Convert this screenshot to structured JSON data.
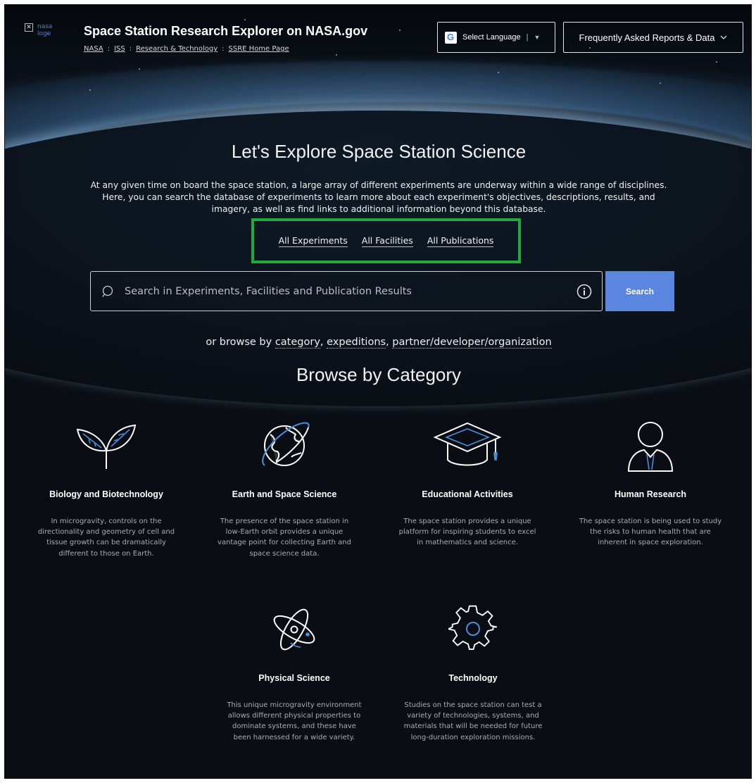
{
  "header": {
    "logo_alt": "nasa logo",
    "title": "Space Station Research Explorer on NASA.gov",
    "breadcrumbs": [
      "NASA",
      "ISS",
      "Research & Technology",
      "SSRE Home Page"
    ],
    "language_button": "Select Language",
    "language_divider": "|",
    "language_caret": "▼",
    "faq_button": "Frequently Asked Reports & Data"
  },
  "hero": {
    "title": "Let's Explore Space Station Science",
    "intro": "At any given time on board the space station, a large array of different experiments are underway within a wide range of disciplines. Here, you can search the database of experiments to learn more about each experiment's objectives, descriptions, results, and imagery, as well as find links to additional information beyond this database.",
    "links": [
      "All Experiments",
      "All Facilities",
      "All Publications"
    ]
  },
  "search": {
    "placeholder": "Search in Experiments, Facilities and Publication Results",
    "button": "Search"
  },
  "browse": {
    "prefix": "or browse by ",
    "links": [
      "category",
      "expeditions",
      "partner/developer/organization"
    ],
    "separator": ", ",
    "heading": "Browse by Category"
  },
  "categories": [
    {
      "label": "Biology and Biotechnology",
      "icon": "plant-sprout-icon",
      "desc": "In microgravity, controls on the directionality and geometry of cell and tissue growth can be dramatically different to those on Earth."
    },
    {
      "label": "Earth and Space Science",
      "icon": "globe-orbit-icon",
      "desc": "The presence of the space station in low-Earth orbit provides a unique vantage point for collecting Earth and space science data."
    },
    {
      "label": "Educational Activities",
      "icon": "graduation-cap-icon",
      "desc": "The space station provides a unique platform for inspiring students to excel in mathematics and science."
    },
    {
      "label": "Human Research",
      "icon": "person-bust-icon",
      "desc": "The space station is being used to study the risks to human health that are inherent in space exploration."
    },
    {
      "label": "Physical Science",
      "icon": "atom-icon",
      "desc": "This unique microgravity environment allows different physical properties to dominate systems, and these have been harnessed for a wide variety."
    },
    {
      "label": "Technology",
      "icon": "gear-icon",
      "desc": "Studies on the space station can test a variety of technologies, systems, and materials that will be needed for future long-duration exploration missions."
    }
  ],
  "colors": {
    "background": "#0a0e14",
    "accent_highlight": "#1faa3f",
    "search_button": "#5a86e0",
    "icon_accent": "#4a8fd6"
  }
}
